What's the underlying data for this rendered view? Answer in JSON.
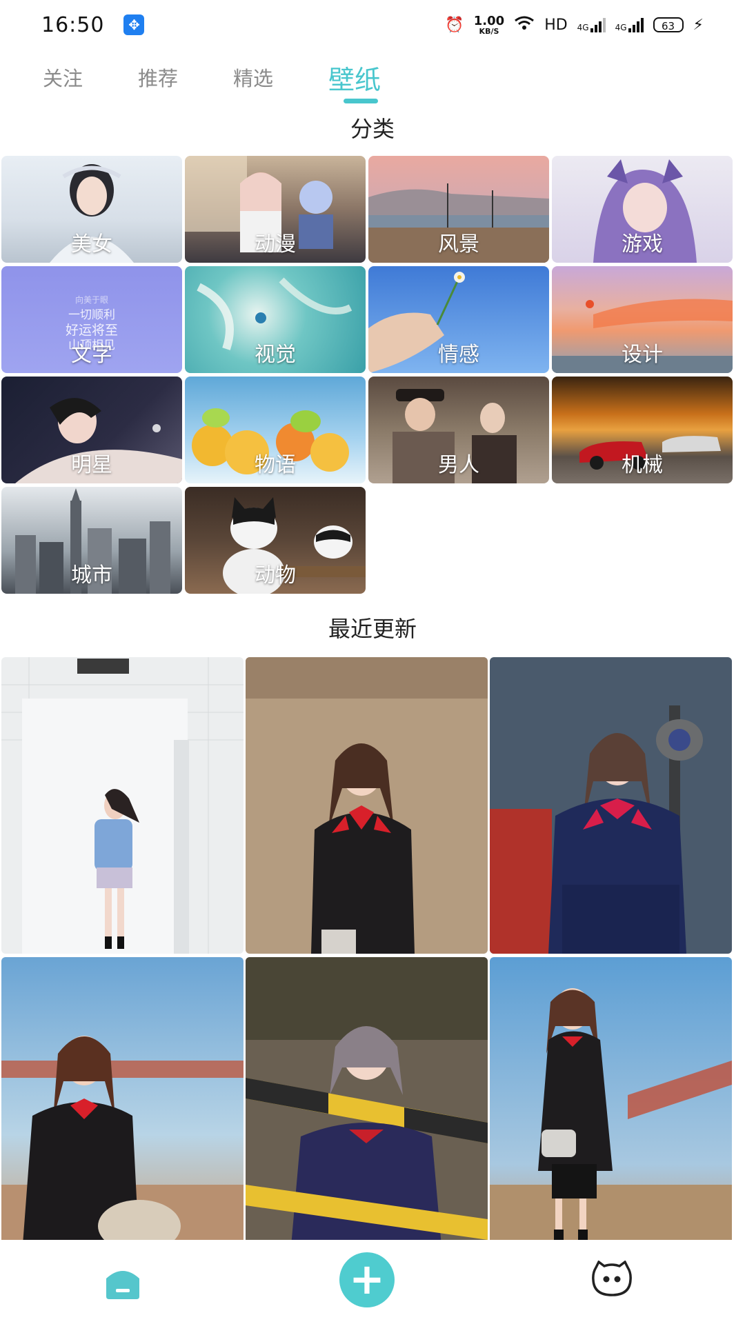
{
  "status_bar": {
    "time": "16:50",
    "speed_value": "1.00",
    "speed_unit": "KB/S",
    "network_label": "HD",
    "signal_1": "4G",
    "signal_2": "4G",
    "battery": "63"
  },
  "tabs": [
    {
      "label": "关注",
      "active": false
    },
    {
      "label": "推荐",
      "active": false
    },
    {
      "label": "精选",
      "active": false
    },
    {
      "label": "壁纸",
      "active": true
    }
  ],
  "categories_title": "分类",
  "categories": [
    {
      "label": "美女"
    },
    {
      "label": "动漫"
    },
    {
      "label": "风景"
    },
    {
      "label": "游戏"
    },
    {
      "label": "文字",
      "art_text": [
        "向美于眼",
        "一切顺利",
        "好运将至",
        "山顶相见"
      ]
    },
    {
      "label": "视觉"
    },
    {
      "label": "情感"
    },
    {
      "label": "设计"
    },
    {
      "label": "明星"
    },
    {
      "label": "物语"
    },
    {
      "label": "男人"
    },
    {
      "label": "机械"
    },
    {
      "label": "城市"
    },
    {
      "label": "动物"
    }
  ],
  "recent_title": "最近更新",
  "recent_photos": [
    {
      "alt": "photo-1"
    },
    {
      "alt": "photo-2"
    },
    {
      "alt": "photo-3"
    },
    {
      "alt": "photo-4"
    },
    {
      "alt": "photo-5"
    },
    {
      "alt": "photo-6"
    }
  ],
  "bottom_nav": {
    "add_glyph": "+",
    "icons": [
      "home-icon",
      "add-icon",
      "chat-face-icon"
    ]
  },
  "colors": {
    "accent": "#48c6cd",
    "tab_inactive": "#8a8a8a"
  }
}
